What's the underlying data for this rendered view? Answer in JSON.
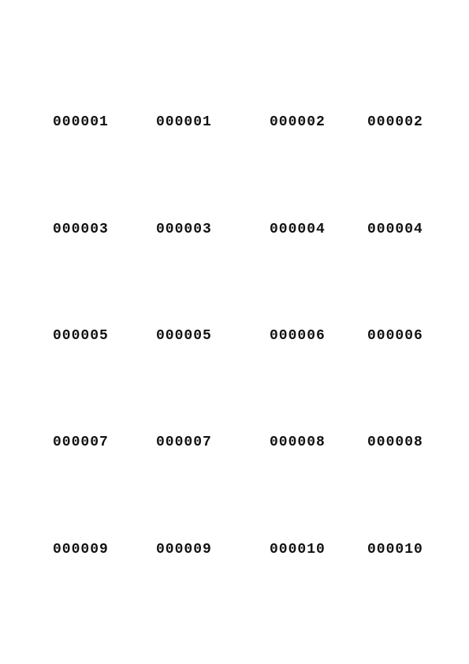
{
  "labels": [
    [
      "000001",
      "000001",
      "000002",
      "000002"
    ],
    [
      "000003",
      "000003",
      "000004",
      "000004"
    ],
    [
      "000005",
      "000005",
      "000006",
      "000006"
    ],
    [
      "000007",
      "000007",
      "000008",
      "000008"
    ],
    [
      "000009",
      "000009",
      "000010",
      "000010"
    ]
  ],
  "colors": {
    "background": "#ffffff",
    "text": "#111111"
  }
}
